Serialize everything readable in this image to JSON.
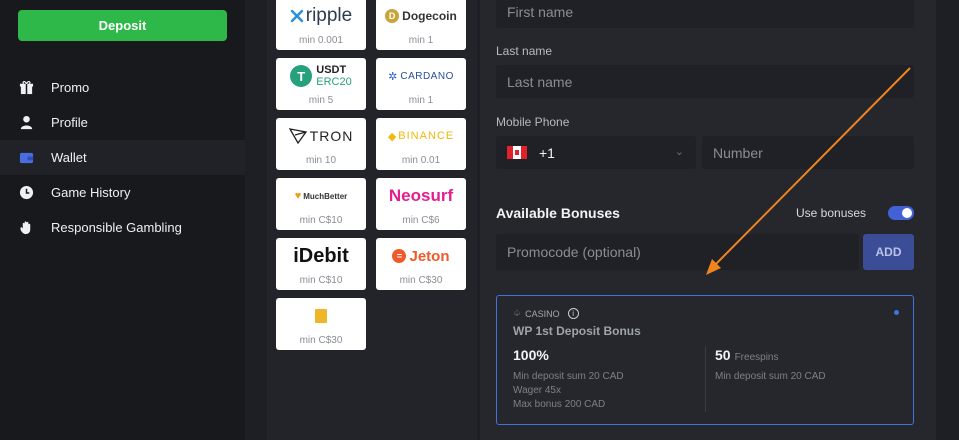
{
  "sidebar": {
    "deposit_label": "Deposit",
    "items": [
      {
        "label": "Promo",
        "icon": "gift-icon"
      },
      {
        "label": "Profile",
        "icon": "user-icon"
      },
      {
        "label": "Wallet",
        "icon": "wallet-icon",
        "active": true
      },
      {
        "label": "Game History",
        "icon": "clock-icon"
      },
      {
        "label": "Responsible Gambling",
        "icon": "hand-icon"
      }
    ]
  },
  "methods": [
    {
      "name": "ripple",
      "min": "min 0.001"
    },
    {
      "name": "Dogecoin",
      "min": "min 1"
    },
    {
      "name": "USDT ERC20",
      "line1": "USDT",
      "line2": "ERC20",
      "min": "min 5"
    },
    {
      "name": "CARDANO",
      "min": "min 1"
    },
    {
      "name": "TRON",
      "min": "min 10"
    },
    {
      "name": "BINANCE",
      "min": "min 0.01"
    },
    {
      "name": "MuchBetter",
      "min": "min C$10"
    },
    {
      "name": "Neosurf",
      "min": "min C$6"
    },
    {
      "name": "iDebit",
      "min": "min C$10"
    },
    {
      "name": "Jeton",
      "min": "min C$30"
    },
    {
      "name": "",
      "min": "min C$30"
    }
  ],
  "form": {
    "first_name_placeholder": "First name",
    "last_name_label": "Last name",
    "last_name_placeholder": "Last name",
    "phone_label": "Mobile Phone",
    "phone_code": "+1",
    "phone_placeholder": "Number",
    "bonuses_title": "Available Bonuses",
    "use_bonuses_label": "Use bonuses",
    "promocode_placeholder": "Promocode (optional)",
    "add_label": "ADD"
  },
  "bonus": {
    "tag": "CASINO",
    "name": "WP 1st Deposit Bonus",
    "percent": "100%",
    "min_deposit": "Min deposit sum 20 CAD",
    "wager": "Wager 45x",
    "max_bonus": "Max bonus 200 CAD",
    "freespins_count": "50",
    "freespins_label": "Freespins",
    "freespins_min_deposit": "Min deposit sum 20 CAD"
  },
  "colors": {
    "accent": "#3e73e0",
    "deposit": "#2eb84a",
    "arrow": "#f0841e"
  }
}
